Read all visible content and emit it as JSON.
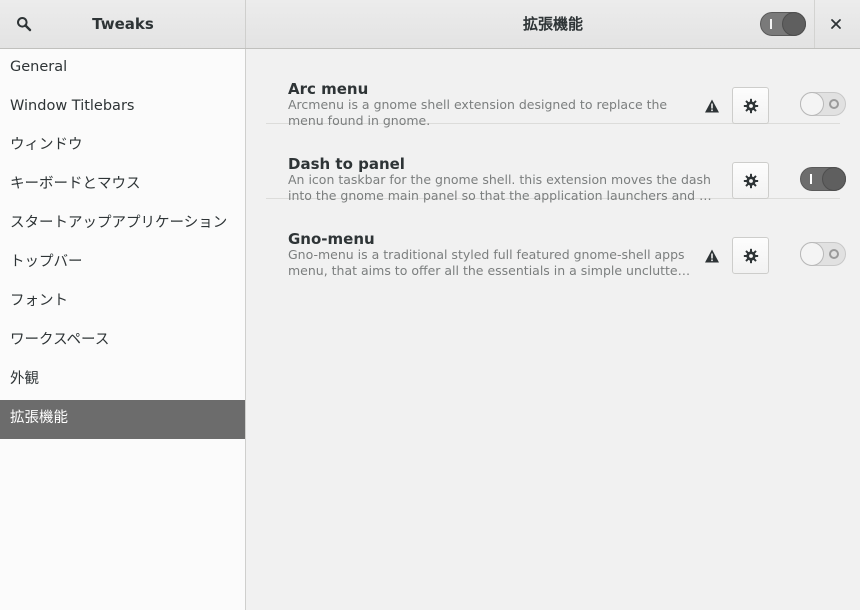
{
  "header": {
    "app_title": "Tweaks",
    "page_title": "拡張機能",
    "global_switch_on": true,
    "search_icon": "search-icon",
    "close_icon": "close-icon"
  },
  "sidebar": {
    "items": [
      {
        "label": "General"
      },
      {
        "label": "Window Titlebars"
      },
      {
        "label": "ウィンドウ"
      },
      {
        "label": "キーボードとマウス"
      },
      {
        "label": "スタートアップアプリケーション"
      },
      {
        "label": "トップバー"
      },
      {
        "label": "フォント"
      },
      {
        "label": "ワークスペース"
      },
      {
        "label": "外観"
      },
      {
        "label": "拡張機能",
        "selected": true
      }
    ]
  },
  "extensions": [
    {
      "name": "Arc menu",
      "desc_line1": "Arcmenu is a gnome shell extension designed to replace the",
      "desc_line2": "menu found in gnome.",
      "warning": true,
      "enabled": false
    },
    {
      "name": "Dash to panel",
      "desc_line1": "An icon taskbar for the gnome shell. this extension moves the dash",
      "desc_line2": "into the gnome main panel so that the application launchers and s…",
      "warning": false,
      "enabled": true
    },
    {
      "name": "Gno-menu",
      "desc_line1": "Gno-menu is a traditional styled full featured gnome-shell apps",
      "desc_line2": "menu, that aims to offer all the essentials in a simple uncluttе…",
      "warning": true,
      "enabled": false
    }
  ],
  "colors": {
    "selected_bg": "#6c6c6c",
    "switch_on": "#6d6d6d"
  }
}
